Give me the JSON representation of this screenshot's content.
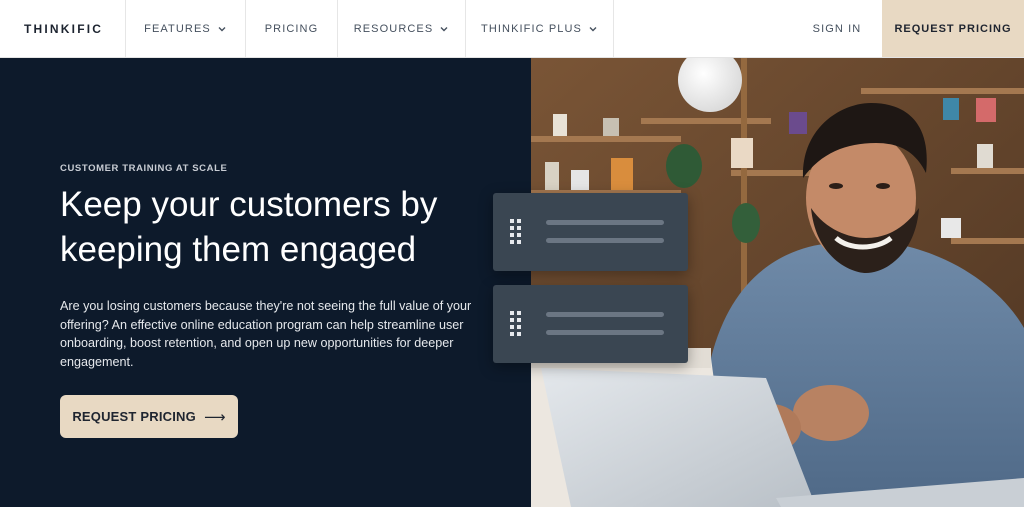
{
  "nav": {
    "logo": "THINKIFIC",
    "items": [
      {
        "label": "FEATURES"
      },
      {
        "label": "PRICING"
      },
      {
        "label": "RESOURCES"
      },
      {
        "label": "THINKIFIC PLUS"
      }
    ],
    "sign_in": "SIGN IN",
    "cta": "REQUEST PRICING"
  },
  "hero": {
    "eyebrow": "CUSTOMER TRAINING AT SCALE",
    "headline": "Keep your customers by keeping them engaged",
    "body": "Are you losing customers because they're not seeing the full value of your offering? An effective online education program can help streamline user onboarding, boost retention, and open up new opportunities for deeper engagement.",
    "cta_label": "REQUEST PRICING",
    "cta_arrow": "⟶"
  },
  "colors": {
    "hero_bg": "#0d1a2b",
    "accent_beige": "#e8d9c3",
    "card_bg": "#3a4652"
  },
  "icons": {
    "chevron": "chevron-down-icon",
    "grip": "drag-handle-icon",
    "arrow": "arrow-right-icon"
  }
}
